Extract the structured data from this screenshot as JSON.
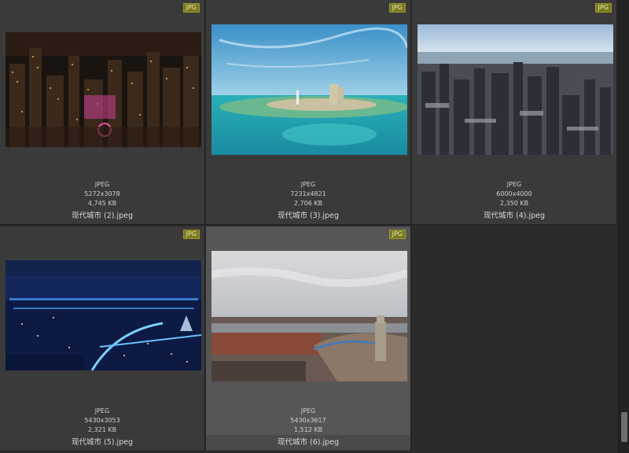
{
  "items": [
    {
      "badge": "JPG",
      "format": "JPEG",
      "dimensions": "5272x3078",
      "size": "4,745 KB",
      "name": "现代城市 (2).jpeg"
    },
    {
      "badge": "JPG",
      "format": "JPEG",
      "dimensions": "7231x4821",
      "size": "2,706 KB",
      "name": "现代城市 (3).jpeg"
    },
    {
      "badge": "JPG",
      "format": "JPEG",
      "dimensions": "6000x4000",
      "size": "2,350 KB",
      "name": "现代城市 (4).jpeg"
    },
    {
      "badge": "JPG",
      "format": "JPEG",
      "dimensions": "5430x3053",
      "size": "2,321 KB",
      "name": "现代城市 (5).jpeg"
    },
    {
      "badge": "JPG",
      "format": "JPEG",
      "dimensions": "5430x3617",
      "size": "1,512 KB",
      "name": "现代城市 (6).jpeg"
    }
  ],
  "selected_index": 4,
  "icons": {
    "scrollbar": "vertical-scrollbar"
  },
  "colors": {
    "badge_bg": "#7b7a22",
    "tile_bg": "#3a3a3a",
    "selected_bg": "#565656"
  }
}
